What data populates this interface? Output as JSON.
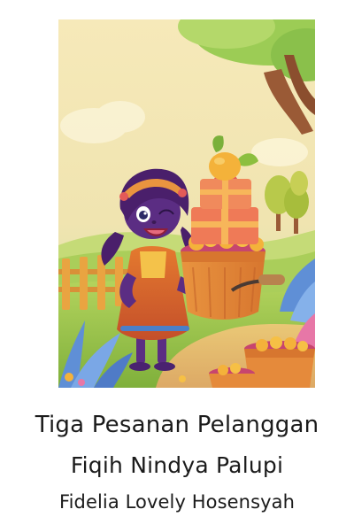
{
  "book": {
    "title": "Tiga Pesanan Pelanggan",
    "author": "Fiqih Nindya Palupi",
    "illustrator": "Fidelia Lovely Hosensyah"
  },
  "cover": {
    "colors": {
      "sky": "#f4e7b6",
      "grass": "#9cc64a",
      "tree_trunk": "#9a5a36",
      "dress": "#d9622b",
      "skin": "#5b2d83",
      "hair": "#4a1f6b",
      "basket": "#e58a3b",
      "gift_boxes": "#ef7a57",
      "mango": "#f4b23a"
    }
  }
}
